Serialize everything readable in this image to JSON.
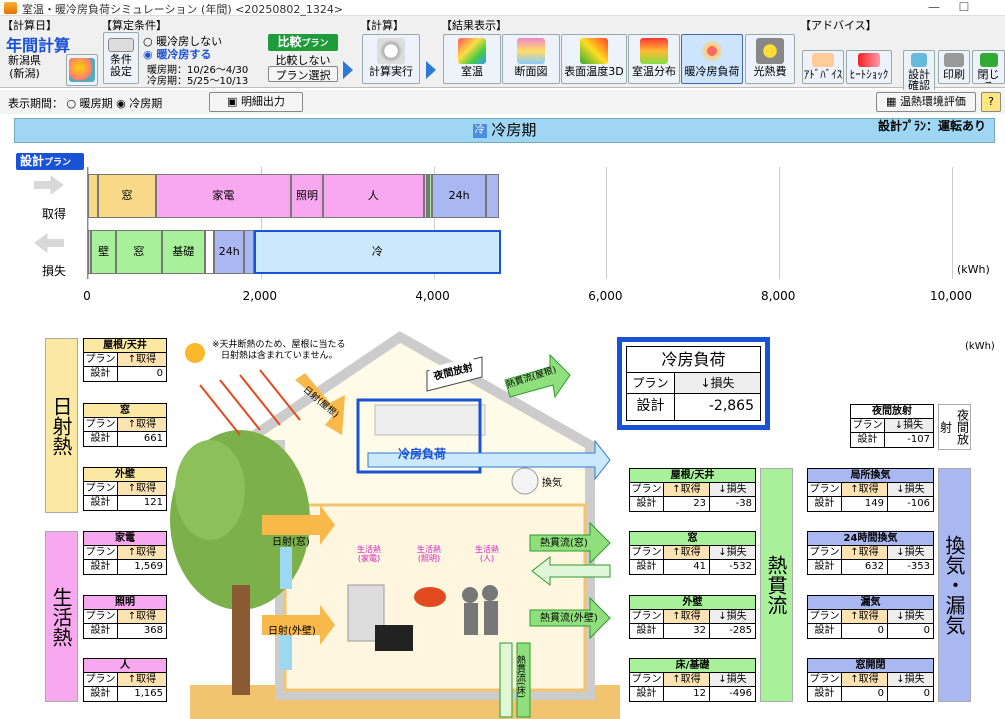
{
  "window": {
    "title": "室温・暖冷房負荷シミュレーション (年間) <20250802_1324>",
    "minimize": "—",
    "maximize": "☐"
  },
  "toolbar": {
    "calc_group": "【計算日】",
    "calc_title": "年間計算",
    "region": "新潟県\n(新潟)",
    "cond_group": "【算定条件】",
    "cond_btn": "条件\n設定",
    "opt_none": "暖冷房しない",
    "opt_do": "暖冷房する",
    "heat_period": "暖房期：10/26～4/30",
    "cool_period": "冷房期：5/25～10/13",
    "compare_btn": "比較",
    "compare_plan": "プラン",
    "compare_none": "比較しない",
    "plan_select": "プラン選択",
    "calc_group2": "【計算】",
    "calc_exec": "計算実行",
    "result_group": "【結果表示】",
    "results": [
      "室温",
      "断面図",
      "表面温度3D",
      "室温分布",
      "暖冷房負荷",
      "光熱費"
    ],
    "advice_group": "【アドバイス】",
    "advice": "ｱﾄﾞﾊﾞｲｽ",
    "heatshock": "ﾋｰﾄｼｮｯｸ",
    "design_check": "設計\n確認",
    "print": "印刷",
    "close": "閉じる"
  },
  "period": {
    "label": "表示期間：",
    "heat": "暖房期",
    "cool": "冷房期",
    "detail_btn": "明細出力",
    "env_btn": "温熱環境評価",
    "help": "?"
  },
  "header": {
    "title": "冷房期",
    "plan_note": "設計ﾌﾟﾗﾝ：運転あり"
  },
  "chart": {
    "plan_tag": "設計",
    "plan_tag_sub": "プラン",
    "gain_label": "取得",
    "loss_label": "損失",
    "unit": "(kWh)",
    "ticks": [
      "0",
      "2,000",
      "4,000",
      "6,000",
      "8,000",
      "10,000"
    ],
    "tick_values": [
      0,
      2000,
      4000,
      6000,
      8000,
      10000
    ]
  },
  "chart_data": {
    "type": "bar",
    "unit": "kWh",
    "xlim": [
      0,
      10000
    ],
    "series": [
      {
        "name": "取得",
        "segments": [
          {
            "label": "壁",
            "value": 121
          },
          {
            "label": "窓",
            "value": 661
          },
          {
            "label": "家電",
            "value": 1569
          },
          {
            "label": "照明",
            "value": 368
          },
          {
            "label": "人",
            "value": 1165
          },
          {
            "label": "窓",
            "value": 41
          },
          {
            "label": "屋根",
            "value": 23
          },
          {
            "label": "壁",
            "value": 32
          },
          {
            "label": "24h",
            "value": 632
          },
          {
            "label": "局",
            "value": 149
          }
        ]
      },
      {
        "name": "損失",
        "segments": [
          {
            "label": "屋",
            "value": 38
          },
          {
            "label": "壁",
            "value": 285
          },
          {
            "label": "窓",
            "value": 532
          },
          {
            "label": "基礎",
            "value": 496
          },
          {
            "label": "放",
            "value": 107
          },
          {
            "label": "24h",
            "value": 353
          },
          {
            "label": "局",
            "value": 106
          },
          {
            "label": "冷",
            "value": 2865
          }
        ]
      }
    ]
  },
  "diagram": {
    "note": "※天井断熱のため、屋根に当たる\n　日射熱は含まれていません。",
    "unit": "(kWh)",
    "sun_heat": "日射熱",
    "life_heat": "生活熱",
    "conduction": "熱貫流",
    "ventilation": "換気・漏気",
    "night_rad": "夜間放射",
    "cool_load_title": "冷房負荷",
    "cool_load_plan": "プラン",
    "cool_load_loss": "↓損失",
    "cool_load_design": "設計",
    "cool_load_value": "-2,865",
    "arrows": {
      "night": "夜間放射",
      "roof": "日射(屋根)",
      "conduct_roof": "熱貫流(屋根)",
      "cooling": "冷房負荷",
      "vent": "換気",
      "win": "日射(窓)",
      "wall": "日射(外壁)",
      "c_win": "熱貫流(窓)",
      "c_wall": "熱貫流(外壁)",
      "c_floor": "熱貫流(床)"
    },
    "life_icons": [
      "生活熱\n(家電)",
      "生活熱\n(照明)",
      "生活熱\n(人)"
    ]
  },
  "col_plan": "プラン",
  "col_design": "設計",
  "col_gain": "↑取得",
  "col_loss": "↓損失",
  "tables": {
    "roof_sun": {
      "title": "屋根/天井",
      "gain": "0"
    },
    "window_sun": {
      "title": "窓",
      "gain": "661"
    },
    "wall_sun": {
      "title": "外壁",
      "gain": "121"
    },
    "appliance": {
      "title": "家電",
      "gain": "1,569"
    },
    "lighting": {
      "title": "照明",
      "gain": "368"
    },
    "person": {
      "title": "人",
      "gain": "1,165"
    },
    "c_roof": {
      "title": "屋根/天井",
      "gain": "23",
      "loss": "-38"
    },
    "c_window": {
      "title": "窓",
      "gain": "41",
      "loss": "-532"
    },
    "c_wall": {
      "title": "外壁",
      "gain": "32",
      "loss": "-285"
    },
    "c_floor": {
      "title": "床/基礎",
      "gain": "12",
      "loss": "-496"
    },
    "night": {
      "title": "夜間放射",
      "loss": "-107"
    },
    "local_vent": {
      "title": "局所換気",
      "gain": "149",
      "loss": "-106"
    },
    "vent24": {
      "title": "24時間換気",
      "gain": "632",
      "loss": "-353"
    },
    "leak": {
      "title": "漏気",
      "gain": "0",
      "loss": "0"
    },
    "window_open": {
      "title": "窓開閉",
      "gain": "0",
      "loss": "0"
    }
  },
  "colors": {
    "wall": "#f8d98a",
    "window": "#f8d98a",
    "appliance": "#f7a8ee",
    "lighting": "#f7a8ee",
    "person": "#f7a8ee",
    "conduct": "#a8f09a",
    "vent": "#aab8f2",
    "cool": "#cce8fb",
    "blue": "#1a52d6"
  }
}
